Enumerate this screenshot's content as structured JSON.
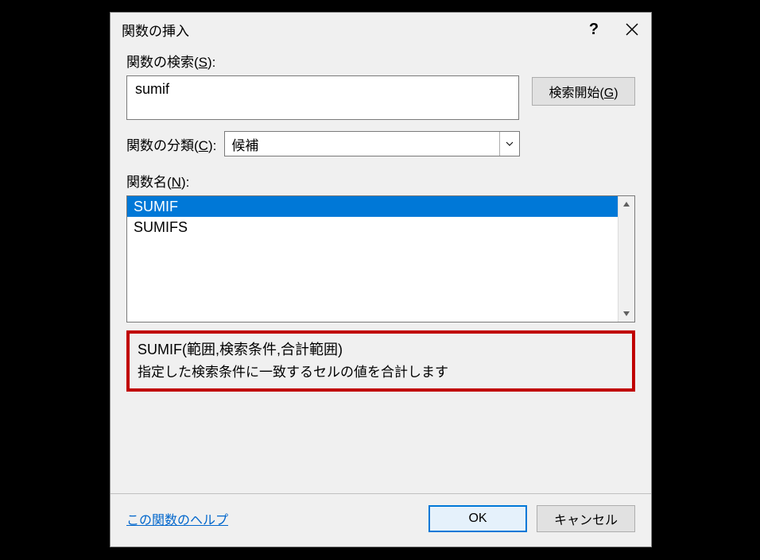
{
  "dialog": {
    "title": "関数の挿入"
  },
  "search": {
    "label_pre": "関数の検索(",
    "label_key": "S",
    "label_post": "):",
    "value": "sumif",
    "go_label_pre": "検索開始(",
    "go_label_key": "G",
    "go_label_post": ")"
  },
  "category": {
    "label_pre": "関数の分類(",
    "label_key": "C",
    "label_post": "):",
    "selected": "候補"
  },
  "list": {
    "label_pre": "関数名(",
    "label_key": "N",
    "label_post": "):",
    "items": [
      "SUMIF",
      "SUMIFS"
    ],
    "selected_index": 0
  },
  "description": {
    "signature": "SUMIF(範囲,検索条件,合計範囲)",
    "text": "指定した検索条件に一致するセルの値を合計します"
  },
  "footer": {
    "help_link": "この関数のヘルプ",
    "ok": "OK",
    "cancel": "キャンセル"
  }
}
